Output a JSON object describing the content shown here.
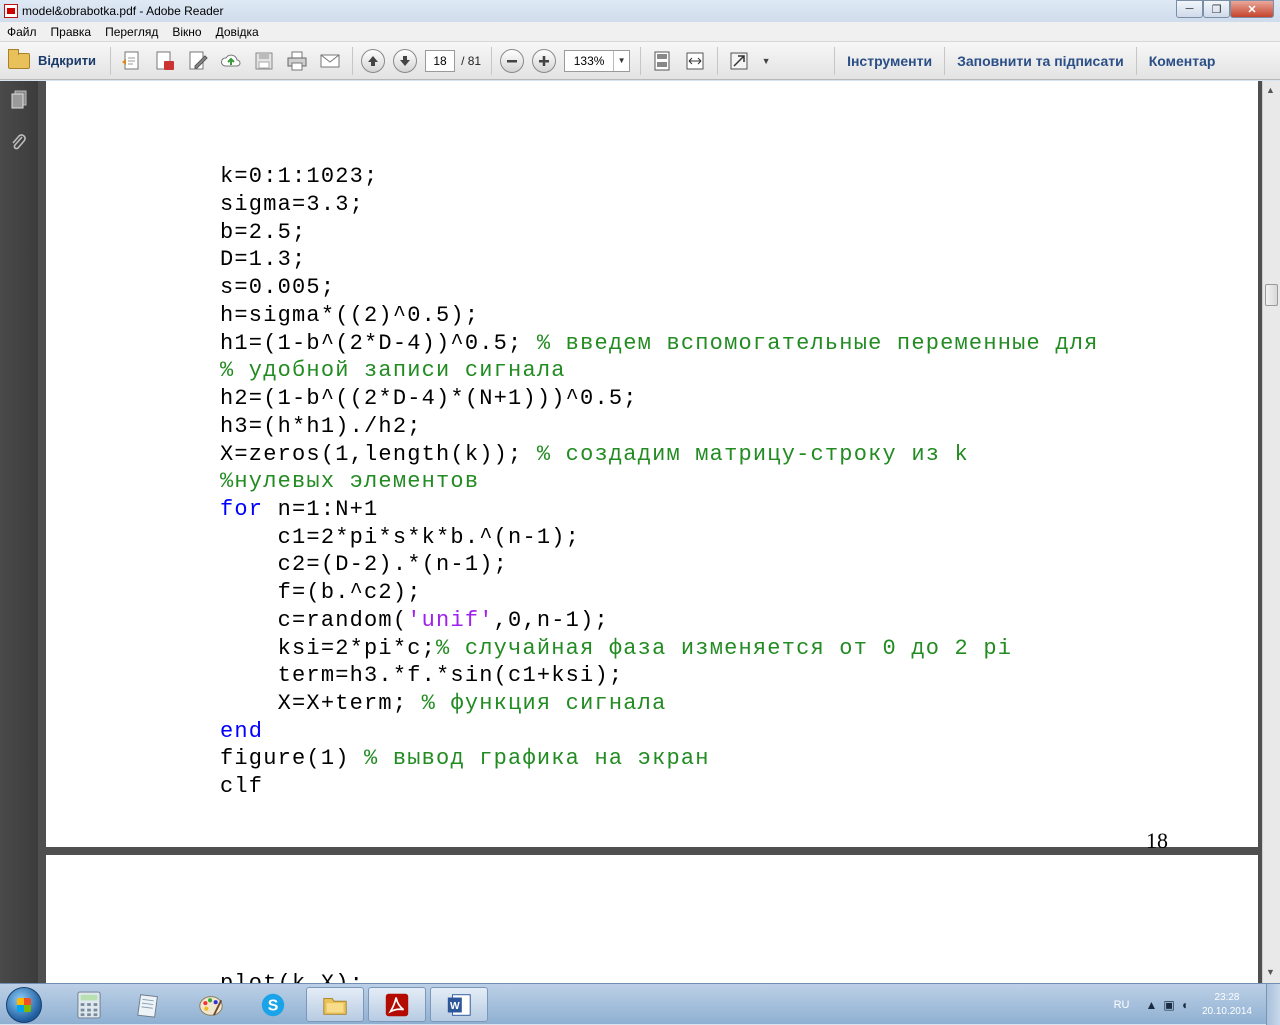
{
  "window": {
    "title": "model&obrabotka.pdf - Adobe Reader",
    "buttons": {
      "minimize": "─",
      "restore": "❐",
      "close": "✕"
    }
  },
  "menu": [
    "Файл",
    "Правка",
    "Перегляд",
    "Вікно",
    "Довідка"
  ],
  "toolbar": {
    "open_label": "Відкрити",
    "page_current": "18",
    "page_total": "/ 81",
    "zoom": "133%",
    "links": [
      "Інструменти",
      "Заповнити та підписати",
      "Коментар"
    ]
  },
  "document": {
    "page_number": "18",
    "code_lines": [
      "k=0:1:1023;",
      "sigma=3.3;",
      "b=2.5;",
      "D=1.3;",
      "s=0.005;",
      "h=sigma*((2)^0.5);",
      "h1=(1-b^(2*D-4))^0.5; % введем вспомогательные переменные для",
      "% удобной записи сигнала",
      "h2=(1-b^((2*D-4)*(N+1)))^0.5;",
      "h3=(h*h1)./h2;",
      "X=zeros(1,length(k)); % создадим матрицу-строку из k",
      "%нулевых элементов",
      "for n=1:N+1",
      "    c1=2*pi*s*k*b.^(n-1);",
      "    c2=(D-2).*(n-1);",
      "    f=(b.^c2);",
      "    c=random('unif',0,n-1);",
      "    ksi=2*pi*c;% случайная фаза изменяется от 0 до 2 pi",
      "    term=h3.*f.*sin(c1+ksi);",
      "    X=X+term; % функция сигнала",
      "end",
      "figure(1) % вывод графика на экран",
      "clf"
    ],
    "next_page_partial_line": "plot(k,X);"
  },
  "taskbar": {
    "language": "RU",
    "time": "23:28",
    "date": "20.10.2014"
  },
  "colors": {
    "keyword": "#0000ff",
    "comment": "#228b22",
    "string": "#a020f0"
  }
}
